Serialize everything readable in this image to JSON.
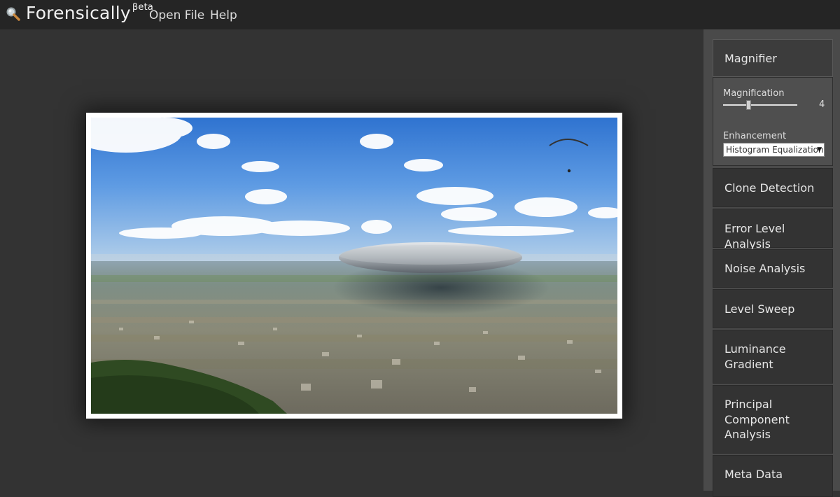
{
  "header": {
    "app_name": "Forensically",
    "app_suffix": "βeta",
    "logo_icon": "magnifier-icon",
    "menu": [
      {
        "label": "Open File"
      },
      {
        "label": "Help"
      }
    ]
  },
  "sidebar": {
    "tools": [
      {
        "label": "Magnifier",
        "active": true
      },
      {
        "label": "Clone Detection"
      },
      {
        "label": "Error Level Analysis"
      },
      {
        "label": "Noise Analysis"
      },
      {
        "label": "Level Sweep"
      },
      {
        "label": "Luminance Gradient"
      },
      {
        "label": "Principal Component Analysis"
      },
      {
        "label": "Meta Data"
      }
    ],
    "magnifier_panel": {
      "magnification_label": "Magnification",
      "magnification_value": "4",
      "enhancement_label": "Enhancement",
      "enhancement_selected": "Histogram Equalization"
    }
  },
  "colors": {
    "topbar": "#252525",
    "background": "#333333",
    "sidebar": "#4a4a4a"
  }
}
